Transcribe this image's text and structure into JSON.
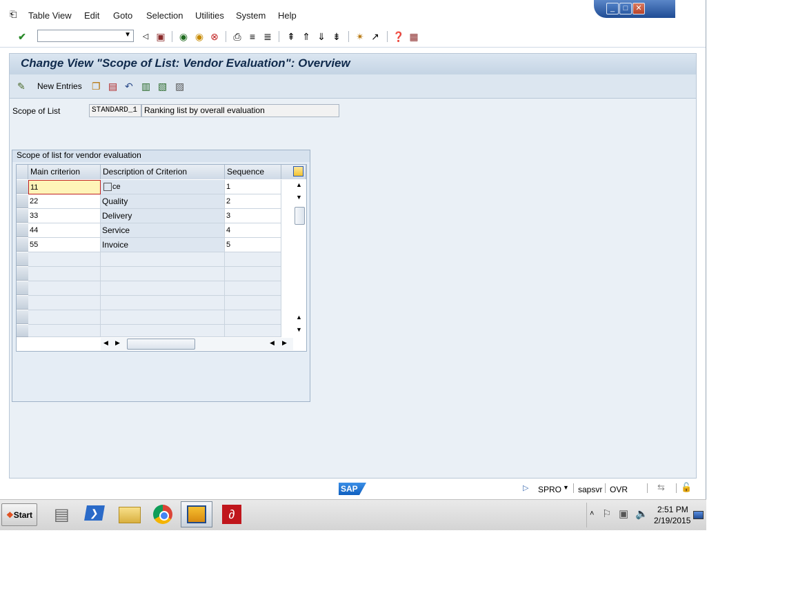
{
  "menu": {
    "items": [
      "Table View",
      "Edit",
      "Goto",
      "Selection",
      "Utilities",
      "System",
      "Help"
    ]
  },
  "window_controls": [
    "minimize-icon",
    "restore-icon",
    "close-icon"
  ],
  "screen": {
    "title": "Change View \"Scope of List: Vendor Evaluation\": Overview",
    "new_entries_label": "New Entries"
  },
  "scope": {
    "label": "Scope of List",
    "value": "STANDARD_1",
    "description": "Ranking list by overall evaluation"
  },
  "table": {
    "group_title": "Scope of list for vendor evaluation",
    "columns": [
      "Main criterion",
      "Description of Criterion",
      "Sequence"
    ],
    "rows": [
      {
        "main": "11",
        "desc": "ce",
        "seq": "1"
      },
      {
        "main": "22",
        "desc": "Quality",
        "seq": "2"
      },
      {
        "main": "33",
        "desc": "Delivery",
        "seq": "3"
      },
      {
        "main": "44",
        "desc": "Service",
        "seq": "4"
      },
      {
        "main": "55",
        "desc": "Invoice",
        "seq": "5"
      },
      {
        "main": "",
        "desc": "",
        "seq": ""
      },
      {
        "main": "",
        "desc": "",
        "seq": ""
      },
      {
        "main": "",
        "desc": "",
        "seq": ""
      },
      {
        "main": "",
        "desc": "",
        "seq": ""
      },
      {
        "main": "",
        "desc": "",
        "seq": ""
      },
      {
        "main": "",
        "desc": "",
        "seq": ""
      }
    ]
  },
  "status": {
    "logo": "SAP",
    "transaction": "SPRO",
    "server": "sapsvr",
    "mode": "OVR"
  },
  "taskbar": {
    "start_label": "Start",
    "time": "2:51 PM",
    "date": "2/19/2015"
  },
  "colors": {
    "accent": "#1f4c94",
    "title_text": "#102a4c",
    "frame_bg": "#eaf0f6"
  }
}
